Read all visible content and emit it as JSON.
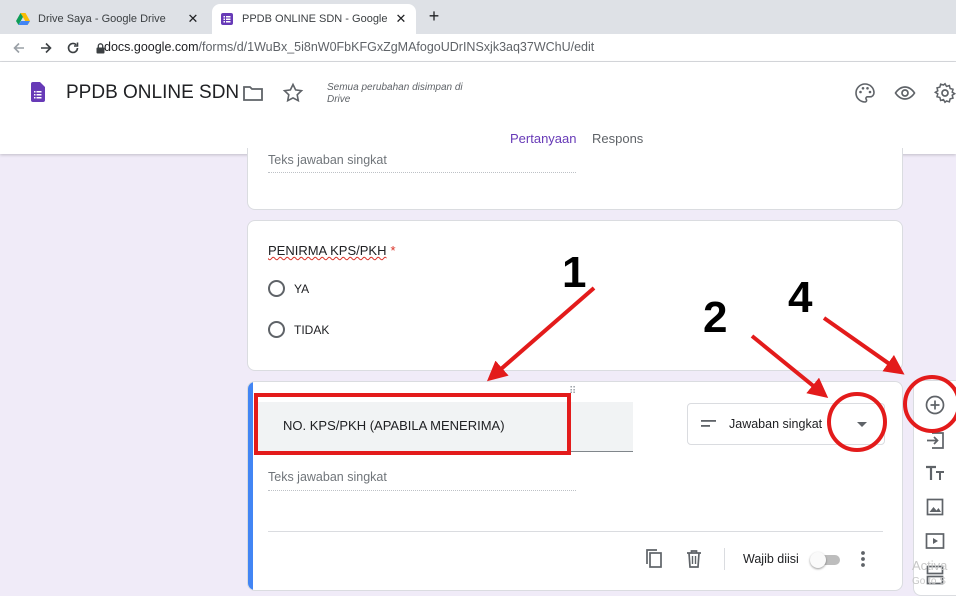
{
  "browser": {
    "tabs": [
      {
        "title": "Drive Saya - Google Drive",
        "close": "✕"
      },
      {
        "title": "PPDB ONLINE SDN - Google For",
        "close": "✕"
      }
    ],
    "new_tab": "+",
    "url_host": "docs.google.com",
    "url_path": "/forms/d/1WuBx_5i8nW0FbKFGxZgMAfogoUDrINSxjk3aq37WChU/edit"
  },
  "header": {
    "title": "PPDB ONLINE SDN",
    "save_status": "Semua perubahan disimpan di Drive",
    "tabs": [
      {
        "label": "Pertanyaan"
      },
      {
        "label": "Respons"
      }
    ]
  },
  "card1": {
    "short_answer": "Teks jawaban singkat"
  },
  "card2": {
    "title": "PENIRMA KPS/PKH",
    "required_mark": "*",
    "options": [
      {
        "label": "YA"
      },
      {
        "label": "TIDAK"
      }
    ]
  },
  "card3": {
    "title": "NO. KPS/PKH (APABILA MENERIMA)",
    "type_label": "Jawaban singkat",
    "short_answer": "Teks jawaban singkat",
    "required_label": "Wajib diisi",
    "required_on": false
  },
  "annotations": {
    "numbers": [
      "1",
      "2",
      "4"
    ],
    "color": "#e31b1b"
  },
  "watermark": {
    "line1": "Activa",
    "line2": "Go to S"
  },
  "colors": {
    "accent": "#673ab7",
    "background": "#f0ebf8",
    "active_card": "#4285f4"
  }
}
